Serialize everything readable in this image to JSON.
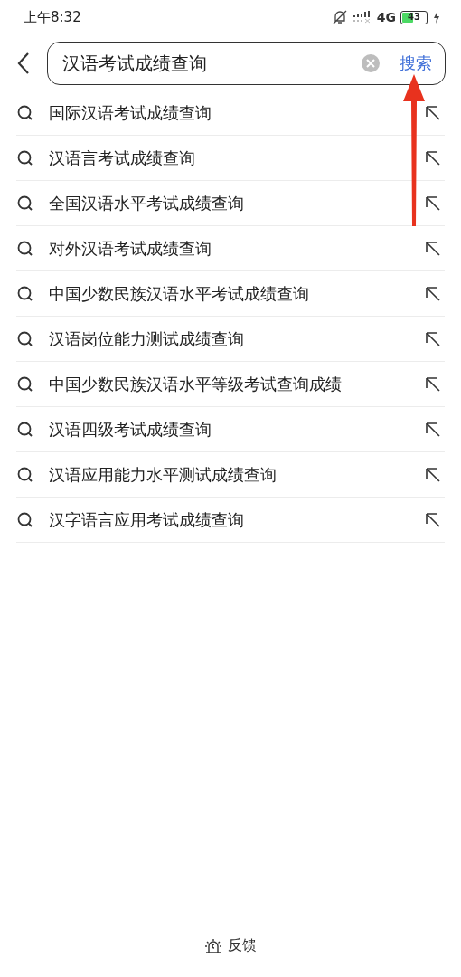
{
  "status_bar": {
    "time": "上午8:32",
    "network": "4G",
    "battery": "43"
  },
  "search": {
    "value": "汉语考试成绩查询",
    "button": "搜索"
  },
  "suggestions": [
    {
      "text": "国际汉语考试成绩查询"
    },
    {
      "text": "汉语言考试成绩查询"
    },
    {
      "text": "全国汉语水平考试成绩查询"
    },
    {
      "text": "对外汉语考试成绩查询"
    },
    {
      "text": "中国少数民族汉语水平考试成绩查询"
    },
    {
      "text": "汉语岗位能力测试成绩查询"
    },
    {
      "text": "中国少数民族汉语水平等级考试查询成绩"
    },
    {
      "text": "汉语四级考试成绩查询"
    },
    {
      "text": "汉语应用能力水平测试成绩查询"
    },
    {
      "text": "汉字语言应用考试成绩查询"
    }
  ],
  "feedback": "反馈"
}
